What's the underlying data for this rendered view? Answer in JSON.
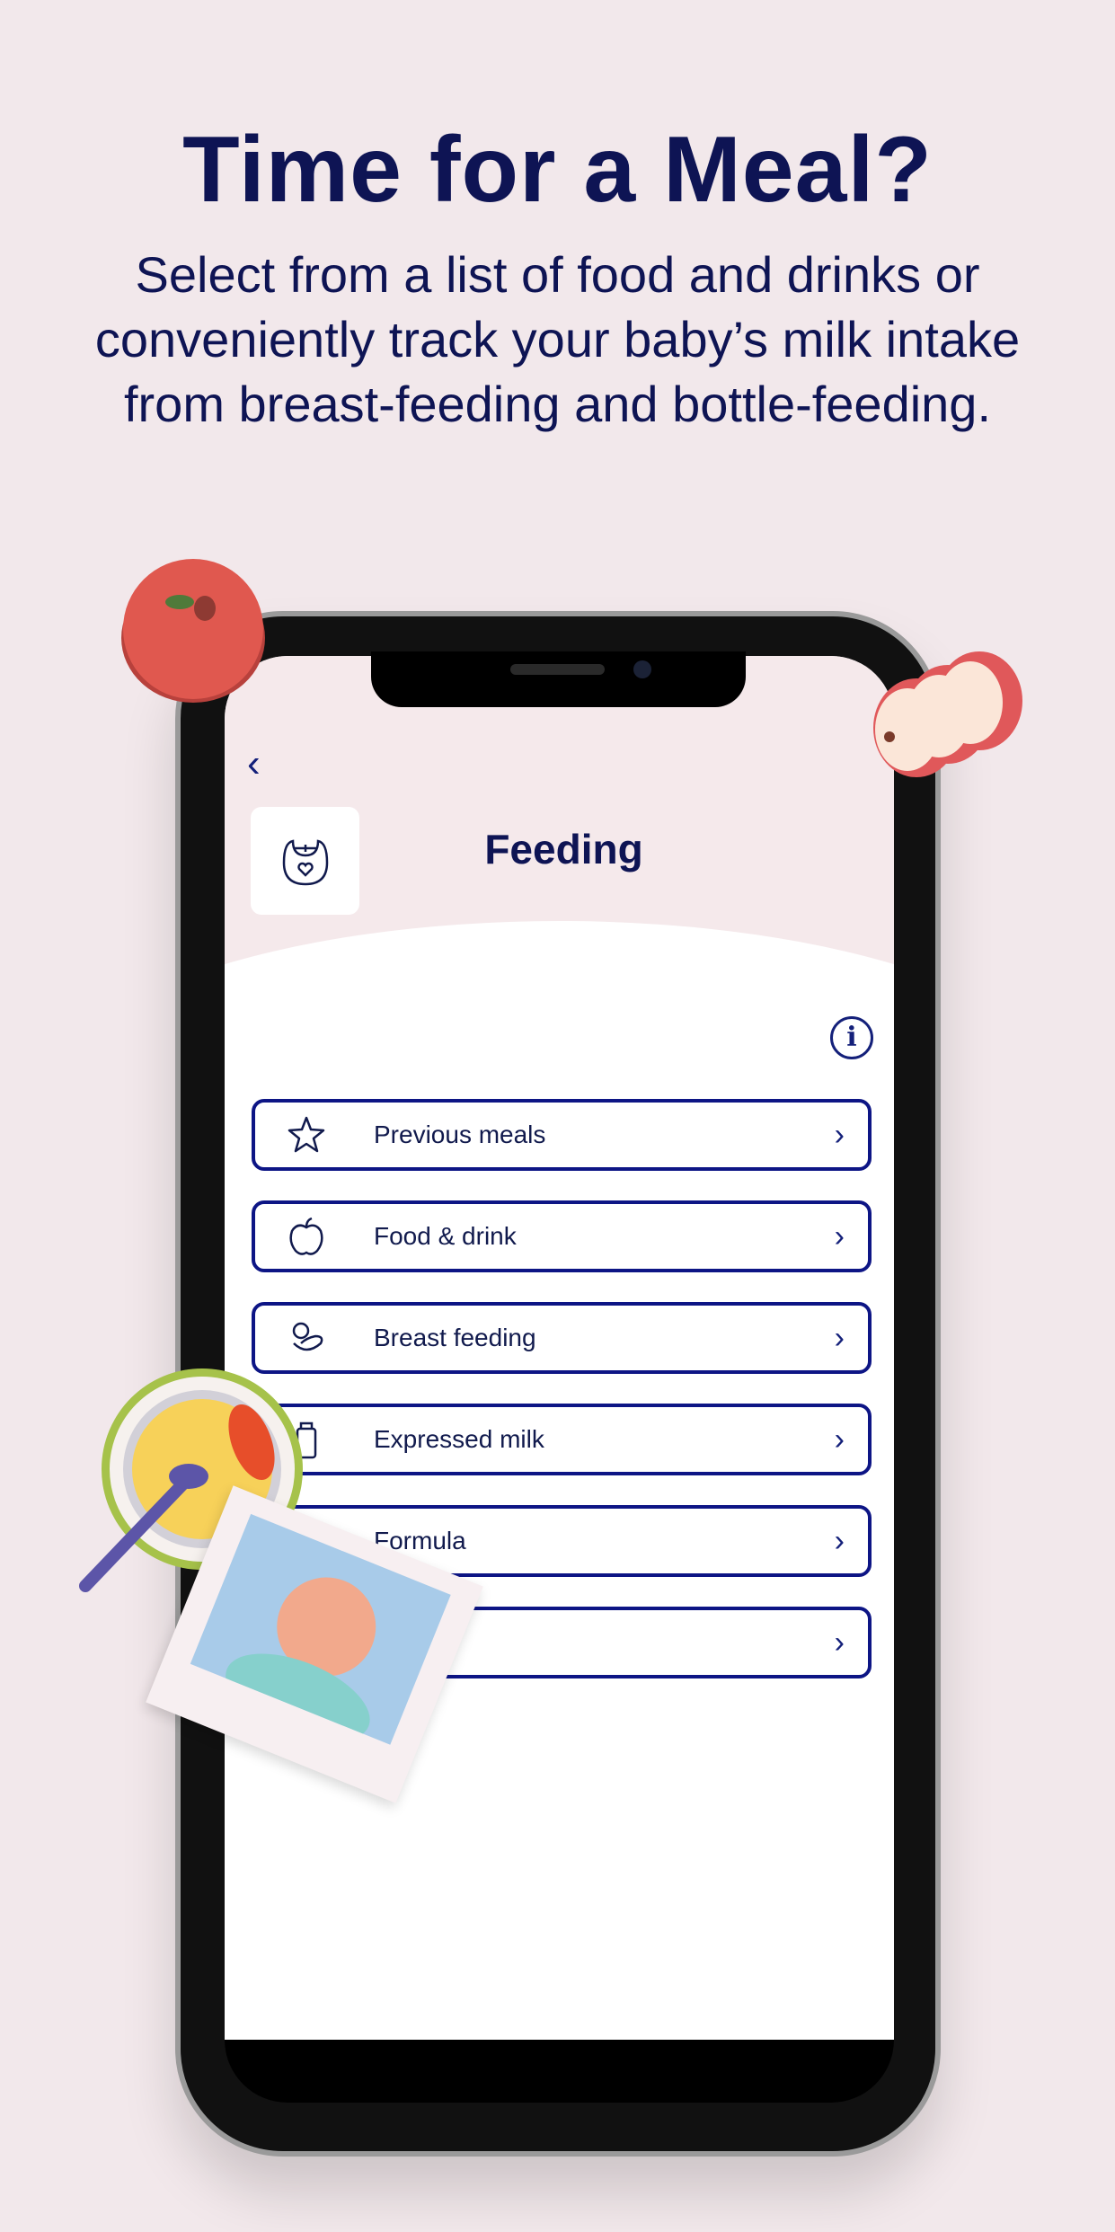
{
  "hero": {
    "title": "Time for a Meal?",
    "subtitle": "Select from a list of food and drinks or conveniently track your baby’s milk intake from breast-feeding and bottle-feeding."
  },
  "app": {
    "back_icon": "chevron-left-icon",
    "header_icon": "bib-icon",
    "title": "Feeding",
    "info_icon": "info-icon",
    "items": [
      {
        "label": "Previous meals",
        "icon": "star-icon"
      },
      {
        "label": "Food & drink",
        "icon": "apple-icon"
      },
      {
        "label": "Breast feeding",
        "icon": "breastfeeding-icon"
      },
      {
        "label": "Expressed milk",
        "icon": "bottle-icon"
      },
      {
        "label": "Formula",
        "icon": "formula-icon"
      },
      {
        "label": "",
        "icon": ""
      }
    ]
  },
  "colors": {
    "background": "#f2e8eb",
    "primary": "#0e1454",
    "border": "#0d1585"
  }
}
